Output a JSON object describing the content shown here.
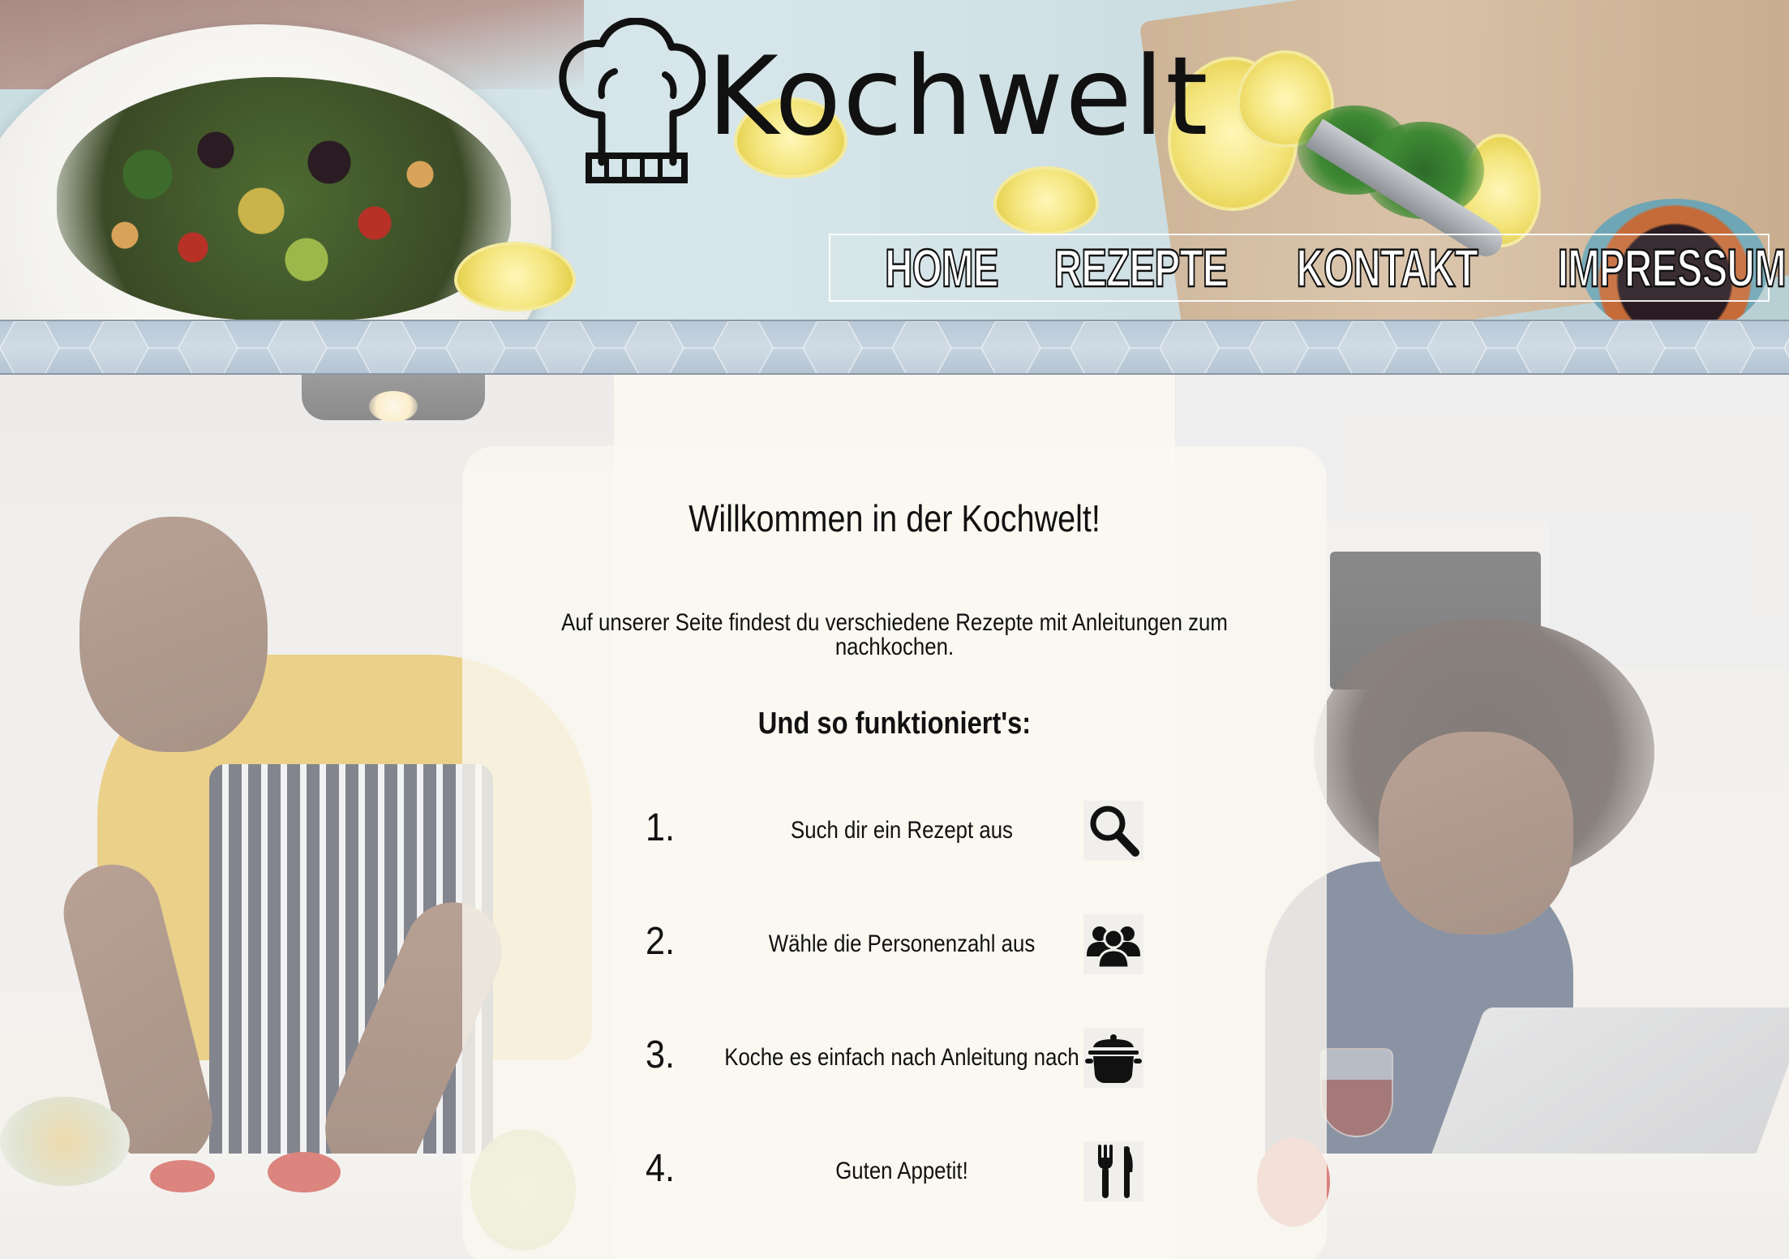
{
  "brand": {
    "name": "Kochwelt"
  },
  "nav": {
    "items": [
      {
        "label": "HOME"
      },
      {
        "label": "REZEPTE"
      },
      {
        "label": "KONTAKT"
      },
      {
        "label": "IMPRESSUM"
      }
    ]
  },
  "main": {
    "title": "Willkommen in der Kochwelt!",
    "intro": "Auf unserer Seite findest du verschiedene Rezepte mit Anleitungen zum nachkochen.",
    "how_title": "Und so funktioniert's:",
    "steps": [
      {
        "number": "1.",
        "text": "Such dir ein Rezept aus",
        "icon": "search-icon"
      },
      {
        "number": "2.",
        "text": "Wähle die Personenzahl aus",
        "icon": "people-icon"
      },
      {
        "number": "3.",
        "text": "Koche es einfach nach Anleitung nach",
        "icon": "cooking-pot-icon"
      },
      {
        "number": "4.",
        "text": "Guten Appetit!",
        "icon": "fork-knife-icon"
      }
    ]
  },
  "colors": {
    "text": "#111111",
    "card_background": "#faf7f0",
    "band": "#b9c9d8",
    "nav_text": "#ffffff"
  }
}
